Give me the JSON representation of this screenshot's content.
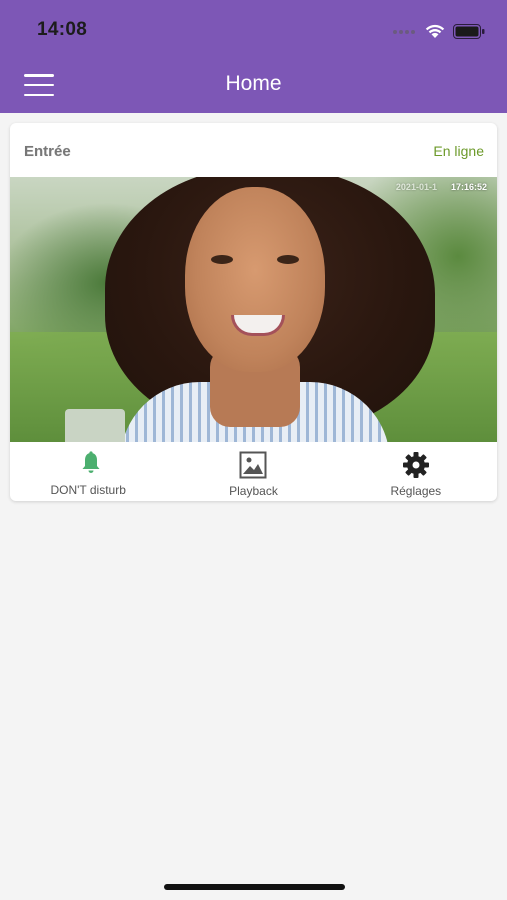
{
  "status_bar": {
    "time": "14:08"
  },
  "header": {
    "title": "Home"
  },
  "device": {
    "name": "Entrée",
    "status": "En ligne",
    "video": {
      "date": "2021-01-1",
      "time": "17:16:52"
    }
  },
  "actions": [
    {
      "label": "DON'T disturb",
      "icon": "bell-icon"
    },
    {
      "label": "Playback",
      "icon": "image-icon"
    },
    {
      "label": "Réglages",
      "icon": "gear-icon"
    }
  ],
  "colors": {
    "primary": "#7d57b6",
    "online": "#6c9a2a",
    "dnd_icon": "#4caf6f",
    "background": "#f4f4f4"
  }
}
